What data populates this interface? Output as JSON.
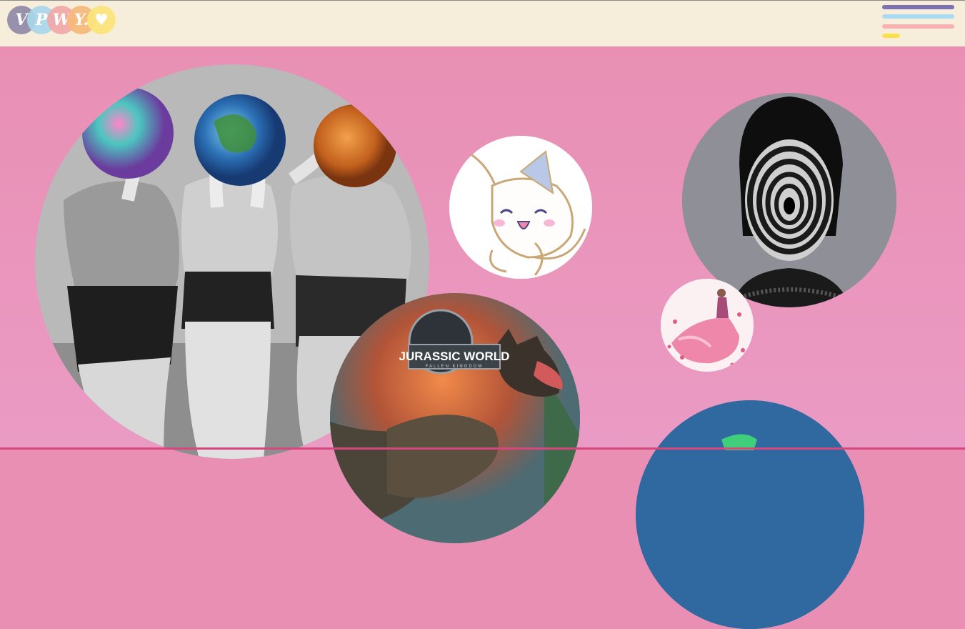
{
  "header": {
    "logo": {
      "letters": [
        {
          "char": "V",
          "color": "#8f8aa8"
        },
        {
          "char": "P",
          "color": "#a9d8ec"
        },
        {
          "char": "W",
          "color": "#f1a9a9"
        },
        {
          "char": "Y.",
          "color": "#f7b97a"
        },
        {
          "char": "♥",
          "color": "#fbe57a"
        }
      ]
    },
    "menu": {
      "icon": "hamburger-menu-icon",
      "lines": [
        "#7f72b0",
        "#a9daf2",
        "#f6b1b0",
        "#fce04b"
      ]
    }
  },
  "colors": {
    "header_bg": "#f6eedb",
    "page_bg": "#e98fb4"
  },
  "gallery": {
    "bubbles": [
      {
        "name": "planet-heads-photo"
      },
      {
        "name": "cinnamoroll-illustration"
      },
      {
        "name": "spiral-face-photo"
      },
      {
        "name": "pink-dress-photo"
      },
      {
        "name": "jurassic-world-poster"
      },
      {
        "name": "blue-bubble-partial"
      }
    ],
    "jurassic_title": "JURASSIC WORLD",
    "jurassic_subtitle": "FALLEN KINGDOM"
  }
}
